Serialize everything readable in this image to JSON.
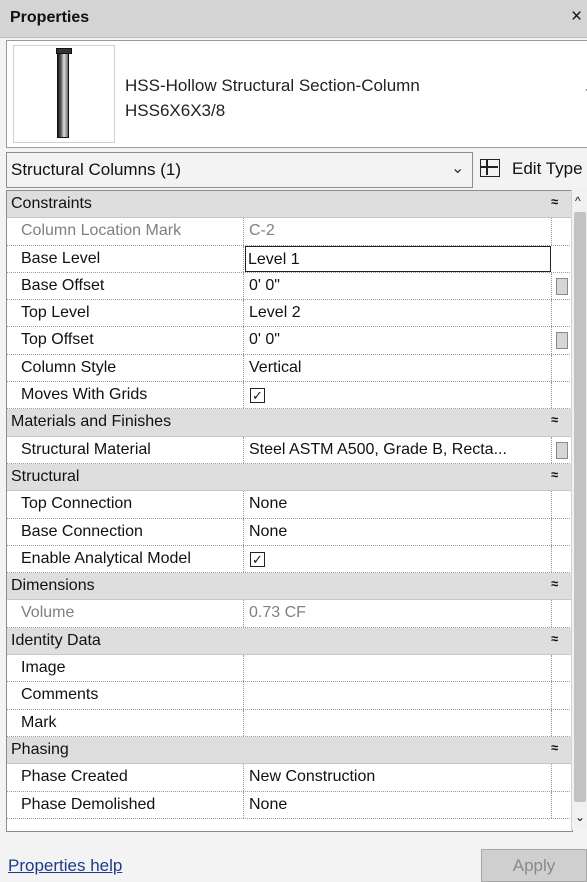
{
  "window": {
    "title": "Properties",
    "close": "×"
  },
  "type_selector": {
    "family": "HSS-Hollow Structural Section-Column",
    "type": "HSS6X6X3/8",
    "dropdown_glyph": "▼"
  },
  "instance_selector": {
    "value": "Structural Columns (1)",
    "chevron": "⌄"
  },
  "edit_type": {
    "label": "Edit Type"
  },
  "groups": [
    {
      "name": "Constraints",
      "collapse": "≈",
      "params": [
        {
          "name": "Column Location Mark",
          "value": "C-2"
        },
        {
          "name": "Base Level",
          "value": "Level 1"
        },
        {
          "name": "Base Offset",
          "value": "0'  0\""
        },
        {
          "name": "Top Level",
          "value": "Level 2"
        },
        {
          "name": "Top Offset",
          "value": "0'  0\""
        },
        {
          "name": "Column Style",
          "value": "Vertical"
        },
        {
          "name": "Moves With Grids",
          "value": "✓"
        }
      ]
    },
    {
      "name": "Materials and Finishes",
      "collapse": "≈",
      "params": [
        {
          "name": "Structural Material",
          "value": "Steel ASTM A500, Grade B, Recta..."
        }
      ]
    },
    {
      "name": "Structural",
      "collapse": "≈",
      "params": [
        {
          "name": "Top Connection",
          "value": "None"
        },
        {
          "name": "Base Connection",
          "value": "None"
        },
        {
          "name": "Enable Analytical Model",
          "value": "✓"
        }
      ]
    },
    {
      "name": "Dimensions",
      "collapse": "≈",
      "params": [
        {
          "name": "Volume",
          "value": "0.73 CF"
        }
      ]
    },
    {
      "name": "Identity Data",
      "collapse": "≈",
      "params": [
        {
          "name": "Image",
          "value": ""
        },
        {
          "name": "Comments",
          "value": ""
        },
        {
          "name": "Mark",
          "value": ""
        }
      ]
    },
    {
      "name": "Phasing",
      "collapse": "≈",
      "params": [
        {
          "name": "Phase Created",
          "value": "New Construction"
        },
        {
          "name": "Phase Demolished",
          "value": "None"
        }
      ]
    }
  ],
  "scrollbar": {
    "up": "^",
    "down": "⌄"
  },
  "footer": {
    "help_link": "Properties help",
    "apply": "Apply"
  }
}
